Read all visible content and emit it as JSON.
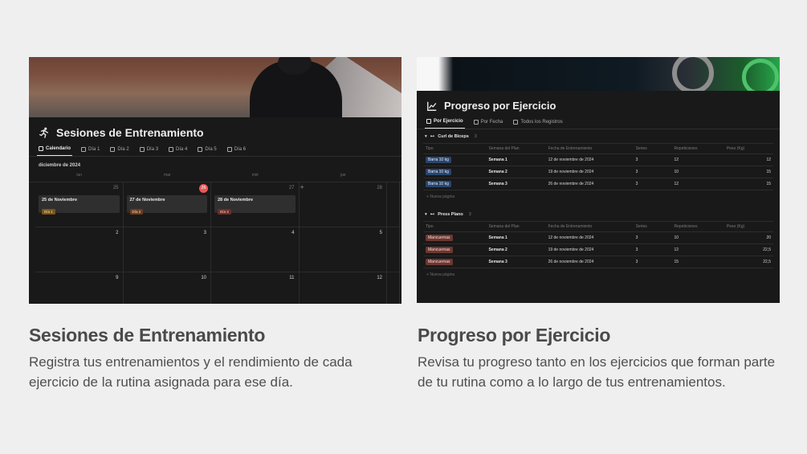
{
  "left": {
    "title": "Sesiones de Entrenamiento",
    "tabs": [
      "Calendario",
      "Día 1",
      "Día 2",
      "Día 3",
      "Día 4",
      "Día 5",
      "Día 6"
    ],
    "month": "diciembre de 2024",
    "weekdays": [
      "lun",
      "mar",
      "mié",
      "jue"
    ],
    "weeks": [
      [
        {
          "n": "25",
          "muted": true
        },
        {
          "n": "26",
          "today": true
        },
        {
          "n": "27",
          "muted": true
        },
        {
          "n": "28",
          "muted": true
        },
        {
          "n": ""
        }
      ],
      [
        {
          "n": "2"
        },
        {
          "n": "3"
        },
        {
          "n": "4"
        },
        {
          "n": "5"
        },
        {
          "n": ""
        }
      ],
      [
        {
          "n": "9"
        },
        {
          "n": "10"
        },
        {
          "n": "11"
        },
        {
          "n": "12"
        },
        {
          "n": ""
        }
      ]
    ],
    "events": [
      {
        "title": "25 de Noviembre",
        "tag": "Día 1",
        "tag_color": "#7a5416"
      },
      {
        "title": "27 de Noviembre",
        "tag": "Día 2",
        "tag_color": "#6e3b1f"
      },
      {
        "title": "28 de Noviembre",
        "tag": "Día 3",
        "tag_color": "#6e2a2a"
      }
    ]
  },
  "right": {
    "title": "Progreso por Ejercicio",
    "tabs": [
      "Por Ejercicio",
      "Por Fecha",
      "Todos los Registros"
    ],
    "columns": [
      "Tipo",
      "Semana del Plan",
      "Fecha de Entrenamiento",
      "Series",
      "Repeticiones",
      "Peso (Kg)"
    ],
    "new_page": "Nueva página",
    "groups": [
      {
        "name": "Curl de Biceps",
        "count": "3",
        "chip_style": "blue",
        "rows": [
          [
            "Barra 10 kg",
            "Semana 1",
            "12 de noviembre de 2024",
            "3",
            "12",
            "12"
          ],
          [
            "Barra 10 kg",
            "Semana 2",
            "19 de noviembre de 2024",
            "3",
            "10",
            "15"
          ],
          [
            "Barra 10 kg",
            "Semana 3",
            "26 de noviembre de 2024",
            "3",
            "12",
            "15"
          ]
        ]
      },
      {
        "name": "Press Plano",
        "count": "3",
        "chip_style": "red",
        "rows": [
          [
            "Mancuernas",
            "Semana 1",
            "12 de noviembre de 2024",
            "3",
            "10",
            "20"
          ],
          [
            "Mancuernas",
            "Semana 2",
            "19 de noviembre de 2024",
            "3",
            "12",
            "22,5"
          ],
          [
            "Mancuernas",
            "Semana 3",
            "26 de noviembre de 2024",
            "3",
            "15",
            "22,5"
          ]
        ]
      }
    ]
  },
  "captions": {
    "left_heading": "Sesiones de Entrenamiento",
    "left_text": "Registra tus entrenamientos y el rendimiento de cada ejercicio de la rutina asignada para ese día.",
    "right_heading": "Progreso por Ejercicio",
    "right_text": "Revisa tu progreso tanto en los ejercicios que forman parte de tu rutina como a lo largo de tus entrenamientos."
  }
}
